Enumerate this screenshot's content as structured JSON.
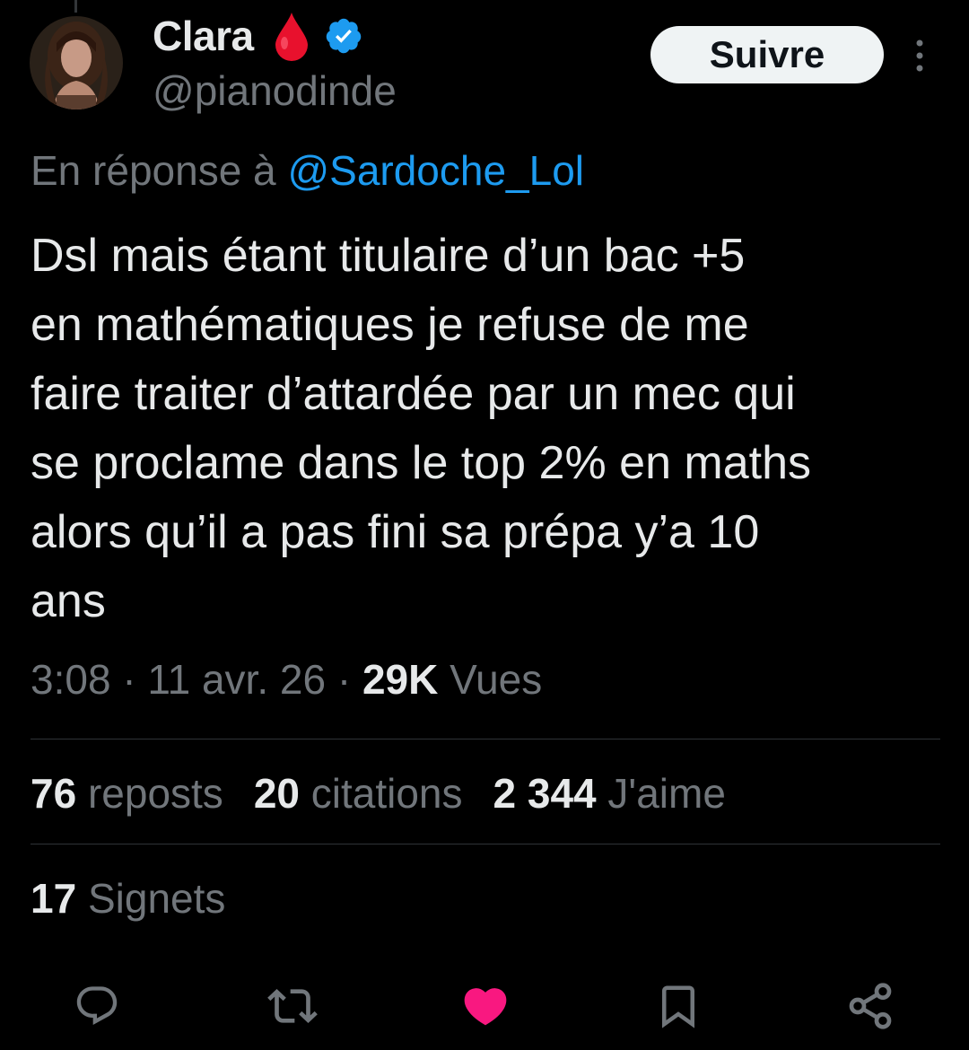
{
  "author": {
    "display_name": "Clara",
    "handle": "@pianodinde"
  },
  "follow_label": "Suivre",
  "reply_context": {
    "prefix": "En réponse à",
    "handle": "@Sardoche_Lol"
  },
  "tweet": {
    "lines": [
      "Dsl mais étant titulaire d’un bac +5",
      "en mathématiques je refuse de me",
      "faire traiter d’attardée par un mec qui",
      "se proclame dans le top 2% en maths",
      "alors qu’il a pas fini sa prépa y’a 10",
      "ans"
    ]
  },
  "meta": {
    "time": "3:08",
    "date": "11 avr. 26",
    "views_count": "29K",
    "views_label": "Vues"
  },
  "stats": {
    "reposts_count": "76",
    "reposts_label": "reposts",
    "quotes_count": "20",
    "quotes_label": "citations",
    "likes_count": "2 344",
    "likes_label": "J'aime",
    "bookmarks_count": "17",
    "bookmarks_label": "Signets"
  },
  "icons": {
    "blood": "blood-drop-icon",
    "verified": "verified-badge-icon",
    "more": "more-vertical-icon",
    "reply": "reply-icon",
    "repost": "repost-icon",
    "like": "heart-icon",
    "bookmark": "bookmark-icon",
    "share": "share-icon"
  },
  "colors": {
    "background": "#000000",
    "text_primary": "#e7e9ea",
    "text_secondary": "#71767b",
    "link": "#1d9bf0",
    "verified": "#1d9bf0",
    "like": "#f91880",
    "blood": "#e8112d",
    "follow_button_bg": "#eff3f4"
  }
}
